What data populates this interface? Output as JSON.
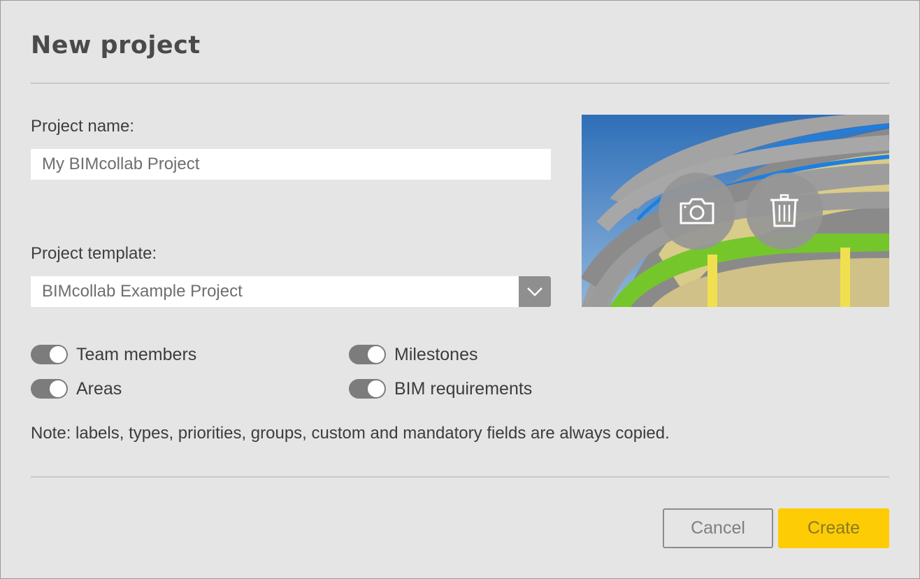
{
  "dialog": {
    "title": "New project"
  },
  "project_name": {
    "label": "Project name:",
    "value": "My BIMcollab Project"
  },
  "project_template": {
    "label": "Project template:",
    "selected": "BIMcollab Example Project"
  },
  "image": {
    "camera_icon": "camera-icon",
    "delete_icon": "trash-icon"
  },
  "toggles": [
    {
      "label": "Team members",
      "on": true
    },
    {
      "label": "Milestones",
      "on": true
    },
    {
      "label": "Areas",
      "on": true
    },
    {
      "label": "BIM requirements",
      "on": true
    }
  ],
  "note": "Note: labels, types, priorities, groups, custom and mandatory fields are always copied.",
  "buttons": {
    "cancel": "Cancel",
    "create": "Create"
  },
  "colors": {
    "accent": "#fdcc05",
    "toggle_on": "#7c7c7c"
  }
}
